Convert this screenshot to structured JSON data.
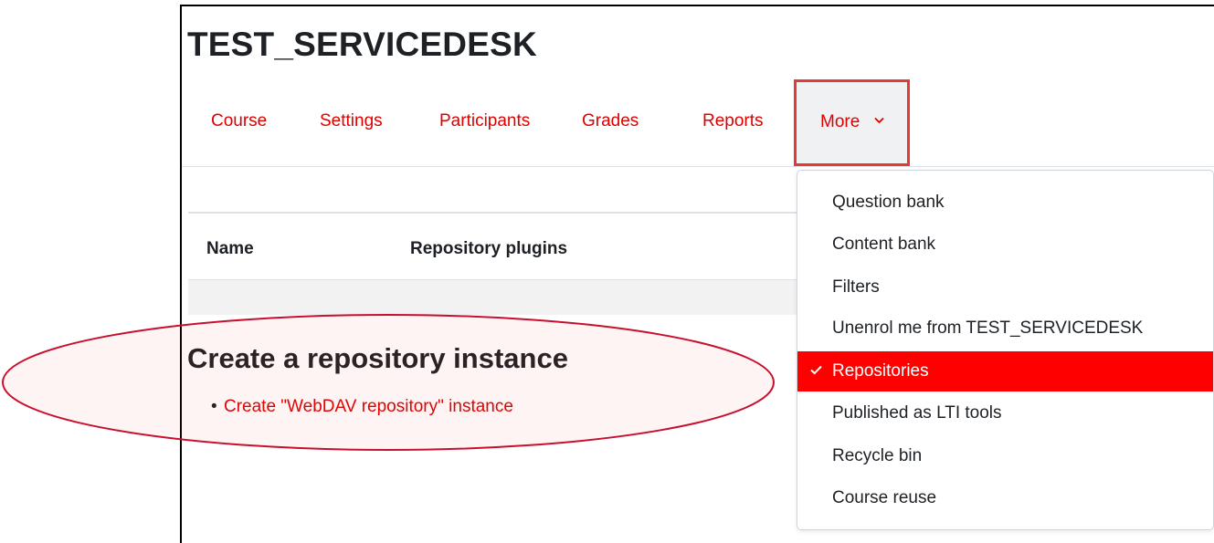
{
  "course": {
    "title": "TEST_SERVICEDESK"
  },
  "nav": {
    "items": [
      "Course",
      "Settings",
      "Participants",
      "Grades",
      "Reports"
    ],
    "more_label": "More"
  },
  "table": {
    "headers": [
      "Name",
      "Repository plugins"
    ]
  },
  "create": {
    "heading": "Create a repository instance",
    "links": [
      "Create \"WebDAV repository\" instance"
    ]
  },
  "more_menu": {
    "items": [
      "Question bank",
      "Content bank",
      "Filters",
      "Unenrol me from TEST_SERVICEDESK",
      "Repositories",
      "Published as LTI tools",
      "Recycle bin",
      "Course reuse"
    ],
    "selected": "Repositories"
  },
  "colors": {
    "link": "#e00000",
    "highlight_border": "#e53935",
    "active_item_bg": "#ff0000",
    "annotation_ellipse": "#c8102e"
  }
}
